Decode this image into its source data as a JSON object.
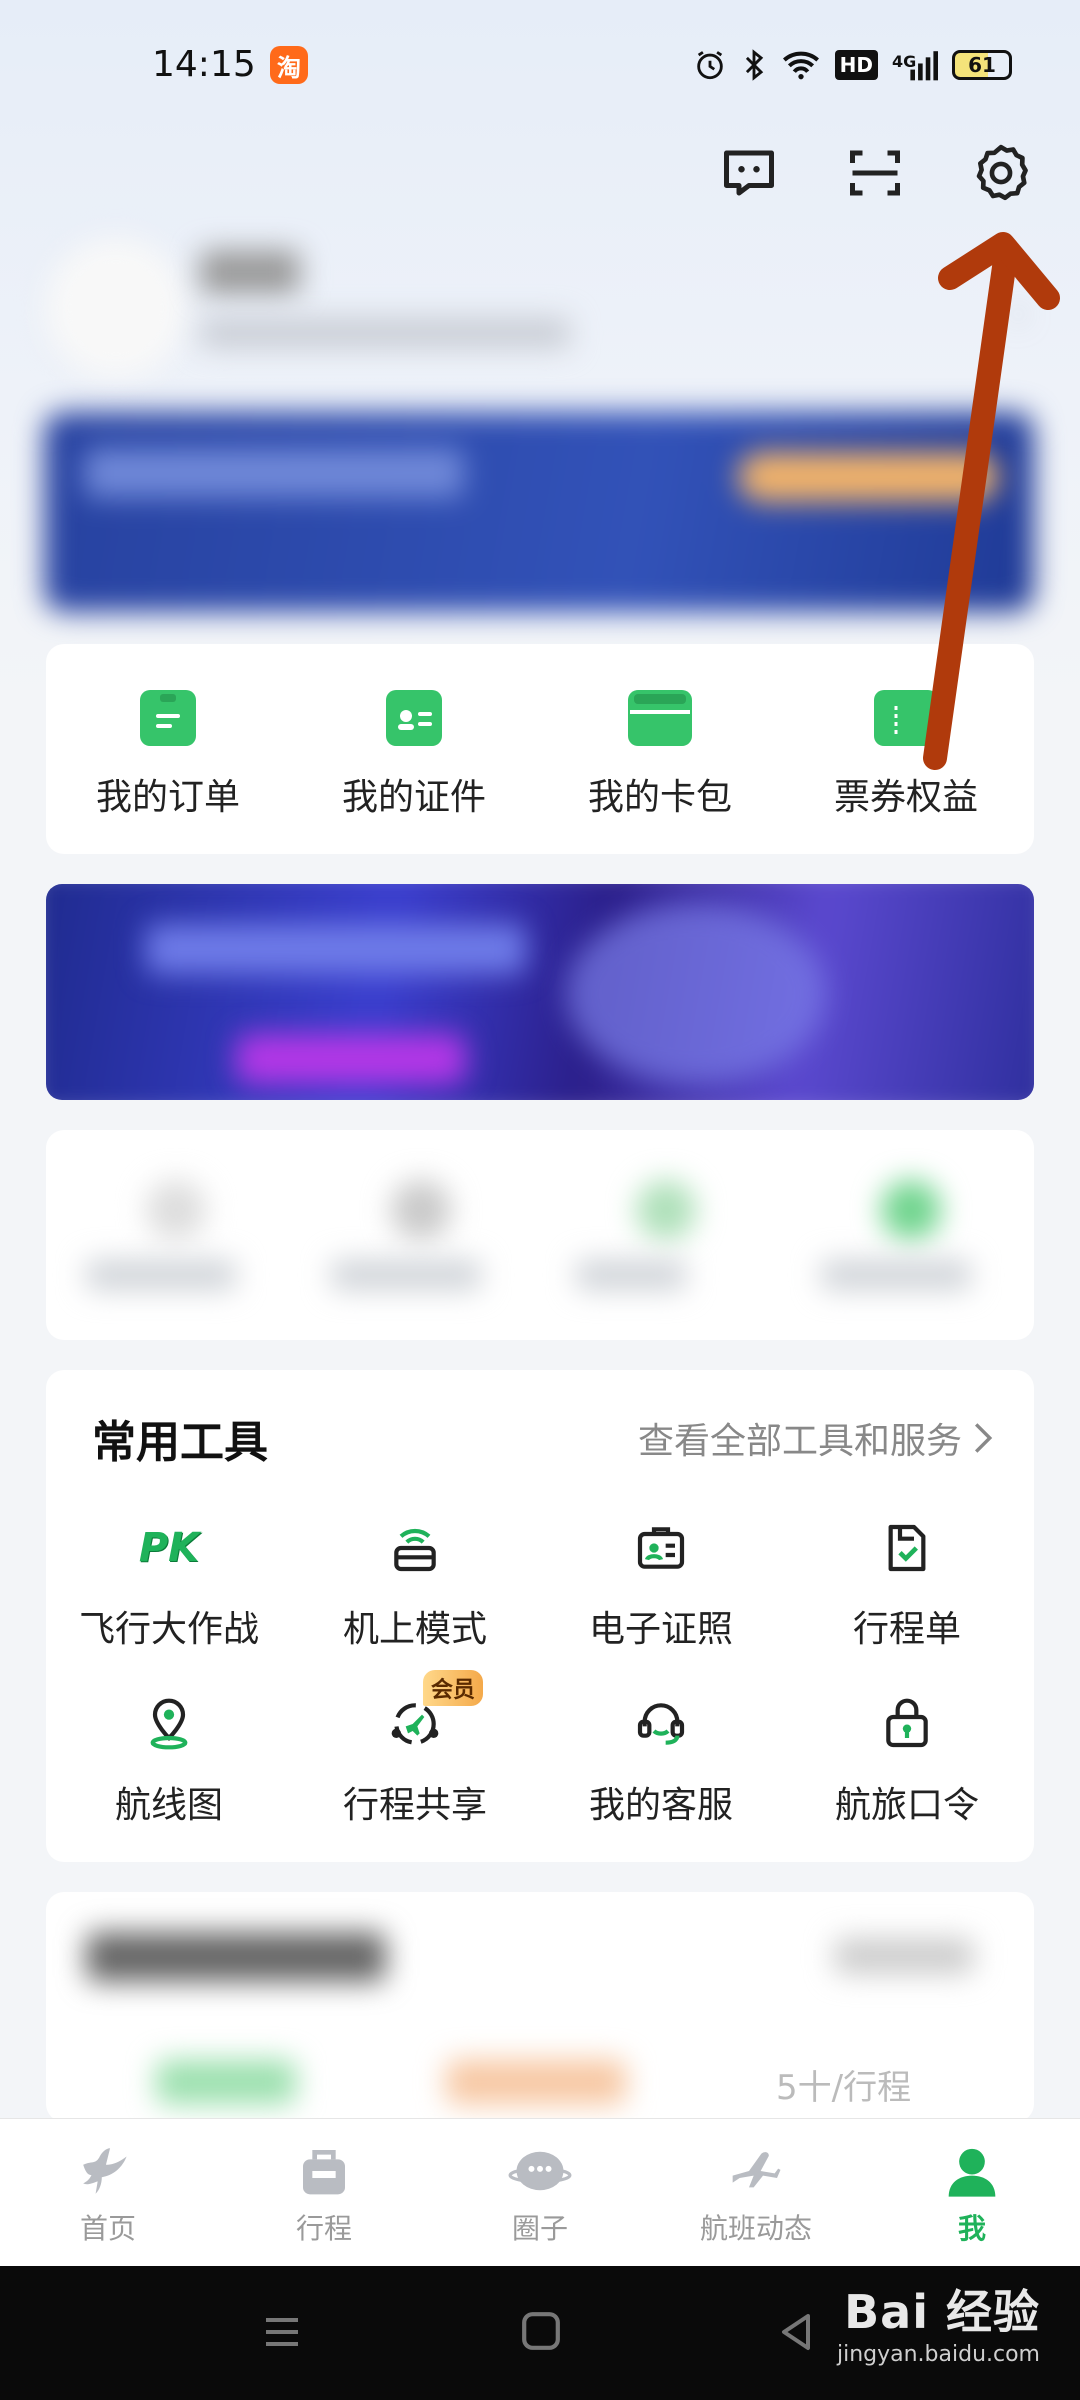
{
  "status_bar": {
    "time": "14:15",
    "app_badge": "淘",
    "network": "4G",
    "hd_label": "HD",
    "battery": "61"
  },
  "header": {
    "icons": [
      "message-icon",
      "scan-icon",
      "settings-icon"
    ]
  },
  "quick_access": {
    "items": [
      {
        "label": "我的订单",
        "icon": "clipboard-icon"
      },
      {
        "label": "我的证件",
        "icon": "id-card-icon"
      },
      {
        "label": "我的卡包",
        "icon": "wallet-icon"
      },
      {
        "label": "票券权益",
        "icon": "ticket-icon"
      }
    ]
  },
  "tools": {
    "title": "常用工具",
    "more_label": "查看全部工具和服务",
    "items": [
      {
        "label": "飞行大作战",
        "icon": "pk-icon",
        "icon_text": "PK"
      },
      {
        "label": "机上模式",
        "icon": "inflight-wifi-icon"
      },
      {
        "label": "电子证照",
        "icon": "e-license-icon"
      },
      {
        "label": "行程单",
        "icon": "itinerary-icon"
      },
      {
        "label": "航线图",
        "icon": "route-map-icon"
      },
      {
        "label": "行程共享",
        "icon": "trip-share-icon",
        "tag": "会员"
      },
      {
        "label": "我的客服",
        "icon": "customer-service-icon"
      },
      {
        "label": "航旅口令",
        "icon": "password-lock-icon"
      }
    ]
  },
  "bottom_nav": {
    "items": [
      {
        "label": "首页",
        "icon": "home-icon"
      },
      {
        "label": "行程",
        "icon": "luggage-icon"
      },
      {
        "label": "圈子",
        "icon": "community-icon"
      },
      {
        "label": "航班动态",
        "icon": "plane-icon"
      },
      {
        "label": "我",
        "icon": "profile-icon"
      }
    ],
    "active_index": 4
  },
  "partial_text": "5十/行程",
  "watermark": {
    "brand": "Bai 经验",
    "url": "jingyan.baidu.com"
  },
  "colors": {
    "accent_green": "#1fb25a",
    "annotation_arrow": "#b03a0c"
  }
}
